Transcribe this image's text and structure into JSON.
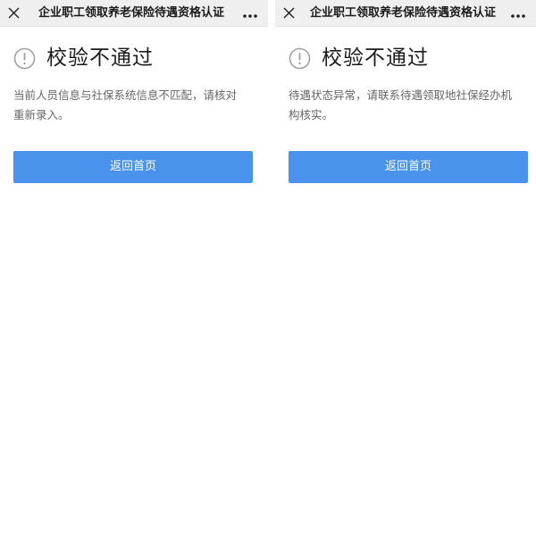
{
  "screens": [
    {
      "title": "企业职工领取养老保险待遇资格认证",
      "heading": "校验不通过",
      "message": "当前人员信息与社保系统信息不匹配，请核对重新录入。",
      "button_label": "返回首页"
    },
    {
      "title": "企业职工领取养老保险待遇资格认证",
      "heading": "校验不通过",
      "message": "待遇状态异常，请联系待遇领取地社保经办机构核实。",
      "button_label": "返回首页"
    }
  ],
  "icons": {
    "close": "close-icon",
    "more": "more-icon",
    "alert": "alert-circle-icon"
  },
  "colors": {
    "titlebar_bg": "#efefef",
    "button_bg": "#4a93ec",
    "heading_text": "#1b1b1b",
    "message_text": "#666666",
    "alert_icon": "#a0a0a0"
  }
}
